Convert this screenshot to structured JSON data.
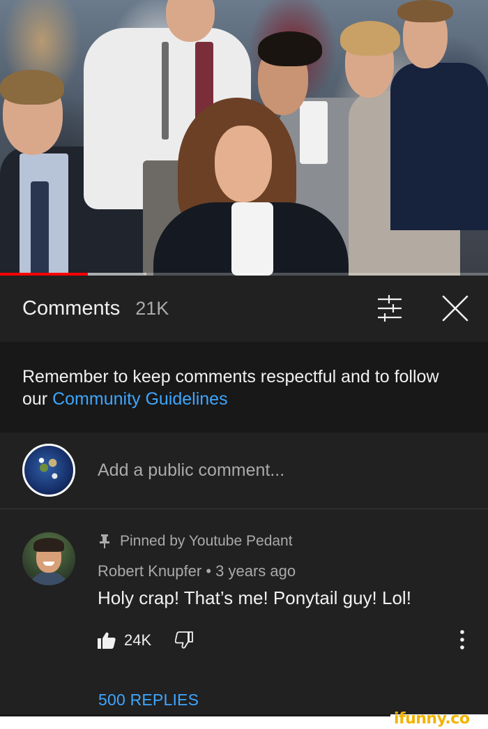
{
  "video": {
    "progress_fraction": 0.18,
    "buffered_fraction": 0.12
  },
  "comments_panel": {
    "title": "Comments",
    "count": "21K",
    "icons": {
      "sort": "sort-filter-icon",
      "close": "close-icon"
    }
  },
  "notice": {
    "text": "Remember to keep comments respectful and to follow our ",
    "link": "Community Guidelines"
  },
  "add_comment": {
    "placeholder": "Add a public comment...",
    "avatar": "earth-avatar"
  },
  "pinned_comment": {
    "pinned_label": "Pinned by Youtube Pedant",
    "author": "Robert Knupfer",
    "separator": " • ",
    "time": "3 years ago",
    "text": "Holy crap! That’s me! Ponytail guy! Lol!",
    "likes": "24K",
    "replies_label": "500 REPLIES",
    "icons": {
      "pin": "pin-icon",
      "like": "thumbs-up-icon",
      "dislike": "thumbs-down-icon",
      "more": "more-vertical-icon"
    }
  },
  "watermark": "ifunny.co",
  "colors": {
    "background": "#212121",
    "link": "#3ea6ff",
    "progress": "#ff0000",
    "watermark": "#f2b400"
  }
}
